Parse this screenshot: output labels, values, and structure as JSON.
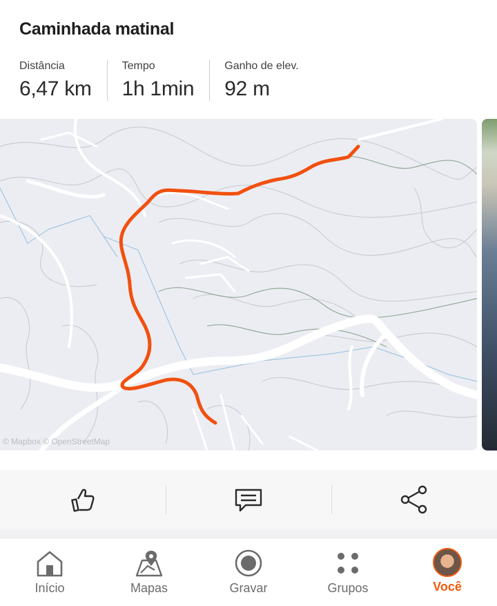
{
  "activity": {
    "title": "Caminhada matinal",
    "stats": [
      {
        "label": "Distância",
        "value": "6,47 km"
      },
      {
        "label": "Tempo",
        "value": "1h 1min"
      },
      {
        "label": "Ganho de elev.",
        "value": "92 m"
      }
    ]
  },
  "map": {
    "attribution": "© Mapbox © OpenStreetMap",
    "route_color": "#f1500f",
    "road_color": "#ffffff",
    "contour_color": "#c7ccd3",
    "water_color": "#9fc7e0"
  },
  "actions": [
    {
      "icon": "thumbs-up-icon"
    },
    {
      "icon": "comment-icon"
    },
    {
      "icon": "share-icon"
    }
  ],
  "nav": {
    "items": [
      {
        "label": "Início",
        "icon": "home-icon"
      },
      {
        "label": "Mapas",
        "icon": "map-pin-icon"
      },
      {
        "label": "Gravar",
        "icon": "record-icon"
      },
      {
        "label": "Grupos",
        "icon": "groups-icon"
      },
      {
        "label": "Você",
        "icon": "avatar",
        "active": true
      }
    ],
    "accent": "#f15a0e"
  }
}
